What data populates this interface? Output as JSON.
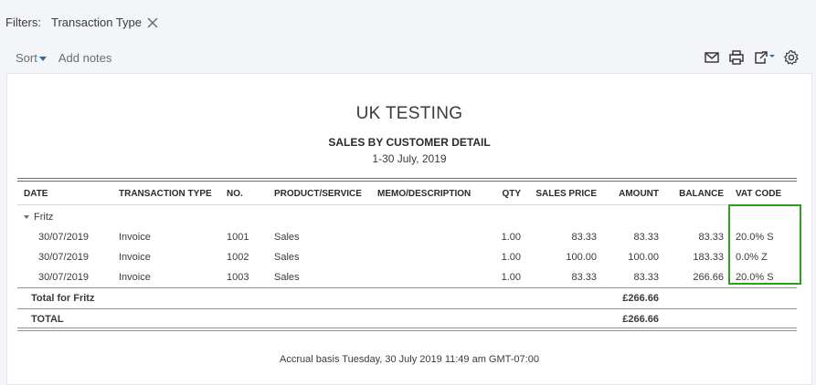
{
  "filters": {
    "label": "Filters:",
    "chip": "Transaction Type"
  },
  "toolbar": {
    "sort": "Sort",
    "add_notes": "Add notes"
  },
  "report": {
    "company": "UK TESTING",
    "title": "SALES BY CUSTOMER DETAIL",
    "period": "1-30 July, 2019",
    "columns": [
      "DATE",
      "TRANSACTION TYPE",
      "NO.",
      "PRODUCT/SERVICE",
      "MEMO/DESCRIPTION",
      "QTY",
      "SALES PRICE",
      "AMOUNT",
      "BALANCE",
      "VAT CODE"
    ],
    "group": "Fritz",
    "rows": [
      {
        "date": "30/07/2019",
        "type": "Invoice",
        "no": "1001",
        "product": "Sales",
        "qty": "1.00",
        "price": "83.33",
        "amount": "83.33",
        "balance": "83.33",
        "vat": "20.0% S"
      },
      {
        "date": "30/07/2019",
        "type": "Invoice",
        "no": "1002",
        "product": "Sales",
        "qty": "1.00",
        "price": "100.00",
        "amount": "100.00",
        "balance": "183.33",
        "vat": "0.0% Z"
      },
      {
        "date": "30/07/2019",
        "type": "Invoice",
        "no": "1003",
        "product": "Sales",
        "qty": "1.00",
        "price": "83.33",
        "amount": "83.33",
        "balance": "266.66",
        "vat": "20.0% S"
      }
    ],
    "group_total_label": "Total for Fritz",
    "group_total_amount": "£266.66",
    "total_label": "TOTAL",
    "total_amount": "£266.66",
    "footer": "Accrual basis  Tuesday, 30 July 2019  11:49 am GMT-07:00"
  },
  "colors": {
    "accent": "#2d6aa0",
    "highlight": "#2ca01c"
  },
  "icons": [
    "close-icon",
    "email-icon",
    "print-icon",
    "export-icon",
    "settings-icon"
  ]
}
